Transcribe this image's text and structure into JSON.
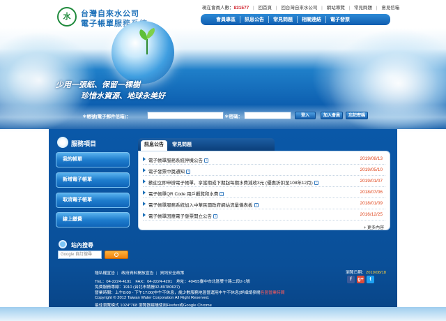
{
  "header": {
    "logo_line1": "台灣自來水公司",
    "logo_line2": "電子帳單服務系統",
    "slogan_line1": "少用一張紙、保留一棵樹",
    "slogan_line2": "珍惜水資源、地球永美好"
  },
  "toplinks": {
    "member_count_label": "現在會員人數：",
    "member_count": "831577",
    "links": [
      "回首頁",
      "回台灣自來水公司",
      "網站導覽",
      "常見問題",
      "意見信箱"
    ]
  },
  "mainnav": [
    "會員專區",
    "訊息公告",
    "常見問題",
    "相關連結",
    "電子發票"
  ],
  "login": {
    "account_label": "＊帳號(電子郵件信箱)：",
    "password_label": "＊密碼：",
    "login_button": "登入",
    "join_button": "加入會員",
    "forgot_button": "忘記密碼"
  },
  "sidebar": {
    "heading": "服務項目",
    "items": [
      "我的帳單",
      "新增電子帳單",
      "取消電子帳單",
      "線上繳費"
    ]
  },
  "site_search": {
    "title": "站內搜尋",
    "placeholder": "Google 自訂搜尋"
  },
  "news": {
    "tabs": [
      "訊息公告",
      "常見問題"
    ],
    "items": [
      {
        "title": "電子帳單服務系統停機公告",
        "date": "2019/08/13"
      },
      {
        "title": "電子發票中獎通知",
        "date": "2019/05/10"
      },
      {
        "title": "歡迎立即申辦電子帳單，享當期或下期起每期水費減收3元 (優惠折扣至108年12月)",
        "date": "2019/01/07"
      },
      {
        "title": "電子帳單QR Code 用戶觀覽和水費",
        "date": "2018/07/06"
      },
      {
        "title": "電子帳單服務系統加入中華民國政府網站流量儀表板",
        "date": "2018/01/09"
      },
      {
        "title": "電子帳單因應電子發票開立公告",
        "date": "2016/12/25"
      }
    ],
    "more": "更多內容"
  },
  "footer": {
    "links": [
      "隱私權宣告",
      "政府資料開放宣告",
      "資訊安全政策"
    ],
    "line_tel": "TEL：04-2224-4191　FAX：04-2224-4201　地址：40455臺中市北區雙十路二段2-1號",
    "line_hotline": "免費服務專線：1910 (台北市請撥02-89780637)",
    "line_hours": "營業時間：上午8:00 - 下午17:00(中午不休息，歲少數服務地區營運用中午不休息)詳細請參閱",
    "line_hours_link": "各區營業時間",
    "copyright": "Copyright © 2012 Taiwan Water Corporation All Right Reserved.",
    "best_view": "最佳瀏覽模式 1024*768 瀏覽器建議使用Firefox或Google Chrome",
    "browse_date_label": "瀏覽日期：",
    "browse_date": "2019/08/18"
  },
  "colors": {
    "brand_blue": "#0a58a8",
    "accent_red": "#d0202b",
    "date_orange": "#e0461c",
    "search_orange": "#f0820f"
  }
}
